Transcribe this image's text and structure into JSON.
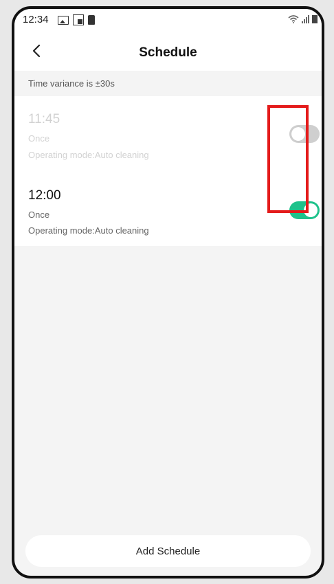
{
  "status_bar": {
    "time": "12:34",
    "left_icons": [
      "photo-icon",
      "flipboard-icon",
      "clipboard-icon"
    ],
    "right_icons": [
      "wifi-icon",
      "signal-icon",
      "battery-icon"
    ]
  },
  "header": {
    "back_icon": "chevron-left-icon",
    "title": "Schedule"
  },
  "notice": "Time variance is ±30s",
  "schedules": [
    {
      "time": "11:45",
      "frequency": "Once",
      "mode": "Operating mode:Auto cleaning",
      "enabled": false
    },
    {
      "time": "12:00",
      "frequency": "Once",
      "mode": "Operating mode:Auto cleaning",
      "enabled": true
    }
  ],
  "add_button": "Add Schedule",
  "colors": {
    "toggle_on": "#1ec28b",
    "toggle_off": "#cfcfcf",
    "highlight": "#e41b1b"
  }
}
